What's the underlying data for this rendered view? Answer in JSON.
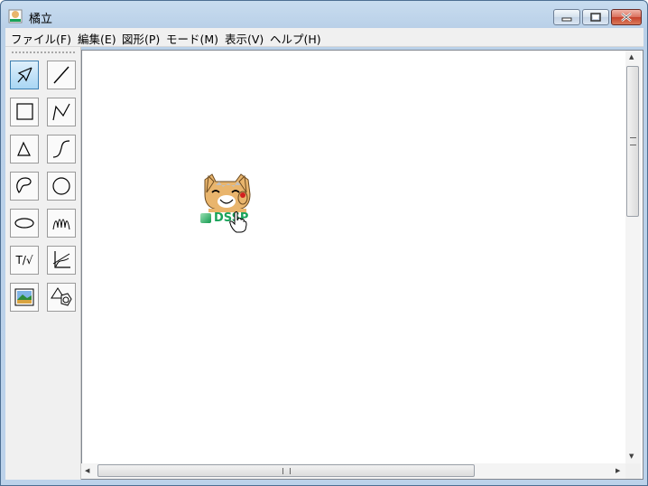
{
  "window": {
    "title": "橘立",
    "controls": [
      "minimize",
      "maximize",
      "close"
    ]
  },
  "menu": {
    "items": [
      {
        "label": "ファイル(F)"
      },
      {
        "label": "編集(E)"
      },
      {
        "label": "図形(P)"
      },
      {
        "label": "モード(M)"
      },
      {
        "label": "表示(V)"
      },
      {
        "label": "ヘルプ(H)"
      }
    ]
  },
  "tools": [
    {
      "name": "select-tool",
      "icon": "arrow-icon",
      "active": true
    },
    {
      "name": "line-tool",
      "icon": "line-icon"
    },
    {
      "name": "rectangle-tool",
      "icon": "square-icon"
    },
    {
      "name": "polyline-tool",
      "icon": "polyline-icon"
    },
    {
      "name": "triangle-tool",
      "icon": "triangle-icon"
    },
    {
      "name": "curve-tool",
      "icon": "curve-icon"
    },
    {
      "name": "freeform-tool",
      "icon": "blob-icon"
    },
    {
      "name": "circle-tool",
      "icon": "circle-icon"
    },
    {
      "name": "ellipse-tool",
      "icon": "ellipse-icon"
    },
    {
      "name": "scribble-tool",
      "icon": "scribble-icon"
    },
    {
      "name": "text-formula-tool",
      "label": "T/√"
    },
    {
      "name": "graph-tool",
      "icon": "graph-axes-icon"
    },
    {
      "name": "image-tool",
      "icon": "picture-icon"
    },
    {
      "name": "shapes-tool",
      "icon": "shapes-icon"
    }
  ],
  "canvas": {
    "logo_text": "DSSP",
    "accent_color": "#19a35a"
  }
}
